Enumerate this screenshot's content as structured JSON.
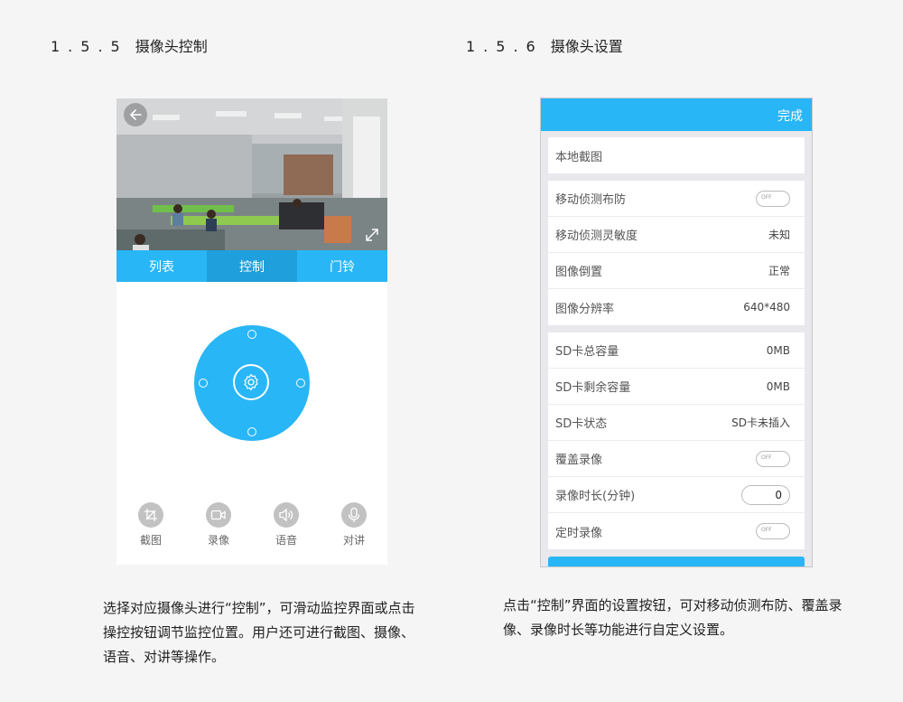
{
  "left_section": {
    "number": "1.5.5",
    "title": "摄像头控制"
  },
  "right_section": {
    "number": "1.5.6",
    "title": "摄像头设置"
  },
  "control_screen": {
    "tabs": [
      "列表",
      "控制",
      "门铃"
    ],
    "active_tab": "控制",
    "tools": [
      {
        "label": "截图",
        "icon": "crop-icon"
      },
      {
        "label": "录像",
        "icon": "video-camera-icon"
      },
      {
        "label": "语音",
        "icon": "speaker-icon"
      },
      {
        "label": "对讲",
        "icon": "microphone-icon"
      }
    ],
    "accent_color": "#29b6f6"
  },
  "settings_screen": {
    "done_label": "完成",
    "groups": [
      [
        {
          "label": "本地截图",
          "type": "none"
        }
      ],
      [
        {
          "label": "移动侦测布防",
          "type": "toggle",
          "value": "OFF"
        },
        {
          "label": "移动侦测灵敏度",
          "type": "text",
          "value": "未知"
        },
        {
          "label": "图像倒置",
          "type": "text",
          "value": "正常"
        },
        {
          "label": "图像分辨率",
          "type": "text",
          "value": "640*480"
        }
      ],
      [
        {
          "label": "SD卡总容量",
          "type": "text",
          "value": "0MB"
        },
        {
          "label": "SD卡剩余容量",
          "type": "text",
          "value": "0MB"
        },
        {
          "label": "SD卡状态",
          "type": "text",
          "value": "SD卡未插入"
        },
        {
          "label": "覆盖录像",
          "type": "toggle",
          "value": "OFF"
        },
        {
          "label": "录像时长(分钟)",
          "type": "number",
          "value": "0"
        },
        {
          "label": "定时录像",
          "type": "toggle",
          "value": "OFF"
        }
      ]
    ]
  },
  "descriptions": {
    "left": "选择对应摄像头进行“控制”，可滑动监控界面或点击操控按钮调节监控位置。用户还可进行截图、摄像、语音、对讲等操作。",
    "right": "点击“控制”界面的设置按钮，可对移动侦测布防、覆盖录像、录像时长等功能进行自定义设置。"
  }
}
